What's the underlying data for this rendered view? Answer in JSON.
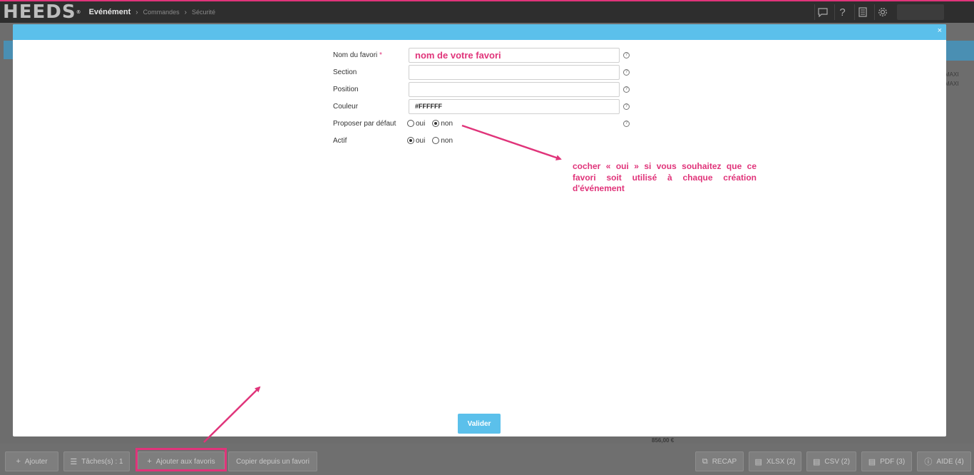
{
  "app": {
    "logo": "HEEDS",
    "logo_mark": "®",
    "breadcrumb": [
      "Evénément",
      "Commandes",
      "Sécurité"
    ]
  },
  "modal": {
    "close_label": "×",
    "fields": {
      "name": {
        "label": "Nom du favori",
        "required_mark": "*",
        "value": "nom de votre favori"
      },
      "section": {
        "label": "Section",
        "value": ""
      },
      "position": {
        "label": "Position",
        "value": ""
      },
      "color": {
        "label": "Couleur",
        "value": "#FFFFFF"
      },
      "default": {
        "label": "Proposer par défaut",
        "yes": "oui",
        "no": "non",
        "selected": "non"
      },
      "active": {
        "label": "Actif",
        "yes": "oui",
        "no": "non",
        "selected": "oui"
      }
    },
    "help_glyph": "?",
    "validate_label": "Valider"
  },
  "annotation": {
    "note": "cocher « oui » si vous souhaitez que ce favori soit utilisé à chaque création d'événement",
    "color": "#e0347a"
  },
  "background": {
    "total": "856,00 €",
    "maxi_1": "MAXI",
    "maxi_2": "MAXI"
  },
  "toolbar": {
    "add": "Ajouter",
    "tasks": "Tâches(s) : 1",
    "add_favorite": "Ajouter aux favoris",
    "copy_favorite": "Copier depuis un favori",
    "recap": "RECAP",
    "xlsx": "XLSX (2)",
    "csv": "CSV (2)",
    "pdf": "PDF (3)",
    "help": "AIDE (4)"
  },
  "colors": {
    "accent": "#5bc0eb",
    "highlight": "#e0347a",
    "topbar": "#2e2e2e"
  }
}
